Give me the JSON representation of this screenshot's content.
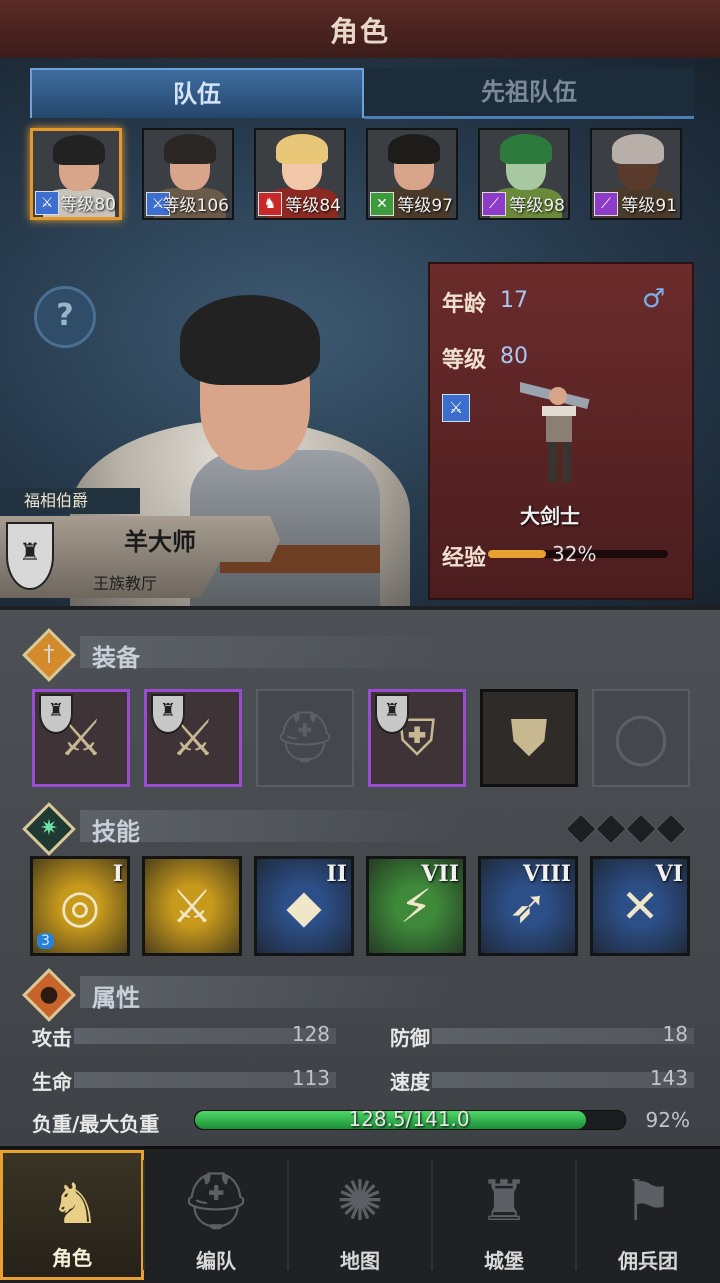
{
  "header": {
    "title": "角色"
  },
  "tabs": [
    {
      "label": "队伍",
      "active": true
    },
    {
      "label": "先祖队伍",
      "active": false
    }
  ],
  "party": [
    {
      "level_text": "等级80",
      "class_icon": "sword-icon",
      "class_color": "#3c6ed0",
      "selected": true
    },
    {
      "level_text": "等级106",
      "class_icon": "sword-icon",
      "class_color": "#3c6ed0",
      "selected": false
    },
    {
      "level_text": "等级84",
      "class_icon": "horse-icon",
      "class_color": "#c82828",
      "selected": false
    },
    {
      "level_text": "等级97",
      "class_icon": "crossed-swords-icon",
      "class_color": "#3c9c3c",
      "selected": false
    },
    {
      "level_text": "等级98",
      "class_icon": "staff-icon",
      "class_color": "#8c3cc8",
      "selected": false
    },
    {
      "level_text": "等级91",
      "class_icon": "staff-icon",
      "class_color": "#8c3cc8",
      "selected": false
    }
  ],
  "character": {
    "age_label": "年龄",
    "age": "17",
    "level_label": "等级",
    "level": "80",
    "gender_symbol": "♂",
    "class_name": "大剑士",
    "exp_label": "经验",
    "exp_pct": "32%",
    "exp_fraction": 0.32,
    "title": "福相伯爵",
    "name": "羊大师",
    "guild": "王族教厅"
  },
  "sections": {
    "equipment": "装备",
    "skills": "技能",
    "attributes": "属性"
  },
  "equipment": [
    {
      "state": "purple",
      "icon": "greatsword-icon"
    },
    {
      "state": "purple",
      "icon": "greatsword-icon"
    },
    {
      "state": "empty",
      "icon": "helmet-icon"
    },
    {
      "state": "purple",
      "icon": "armor-icon"
    },
    {
      "state": "black",
      "icon": "boots-icon"
    },
    {
      "state": "empty",
      "icon": "ring-icon"
    }
  ],
  "skills": [
    {
      "rank": "I",
      "bg": "#c89a1c",
      "glyph": "◎",
      "icon": "whirlwind-icon",
      "badge": "3"
    },
    {
      "rank": "",
      "bg": "#c89a1c",
      "glyph": "⚔",
      "icon": "sword-strike-icon",
      "badge": ""
    },
    {
      "rank": "II",
      "bg": "#2c4f88",
      "glyph": "◆",
      "icon": "crystal-icon",
      "badge": ""
    },
    {
      "rank": "VII",
      "bg": "#3e8a3a",
      "glyph": "⚡",
      "icon": "slash-icon",
      "badge": ""
    },
    {
      "rank": "VIII",
      "bg": "#2c4f88",
      "glyph": "➶",
      "icon": "charge-icon",
      "badge": ""
    },
    {
      "rank": "VI",
      "bg": "#2c4f88",
      "glyph": "✕",
      "icon": "cross-blades-icon",
      "badge": ""
    }
  ],
  "attributes": {
    "attack_label": "攻击",
    "attack": "128",
    "defense_label": "防御",
    "defense": "18",
    "hp_label": "生命",
    "hp": "113",
    "speed_label": "速度",
    "speed": "143",
    "weight_label": "负重/最大负重",
    "weight": "128.5/141.0",
    "weight_pct": "92%",
    "weight_fraction": 0.91
  },
  "nav": [
    {
      "label": "角色",
      "icon": "knight-icon",
      "glyph": "♞",
      "active": true
    },
    {
      "label": "编队",
      "icon": "helmet-icon",
      "glyph": "⛑",
      "active": false
    },
    {
      "label": "地图",
      "icon": "compass-icon",
      "glyph": "✺",
      "active": false
    },
    {
      "label": "城堡",
      "icon": "castle-icon",
      "glyph": "♜",
      "active": false
    },
    {
      "label": "佣兵团",
      "icon": "banner-icon",
      "glyph": "⚑",
      "active": false
    }
  ]
}
